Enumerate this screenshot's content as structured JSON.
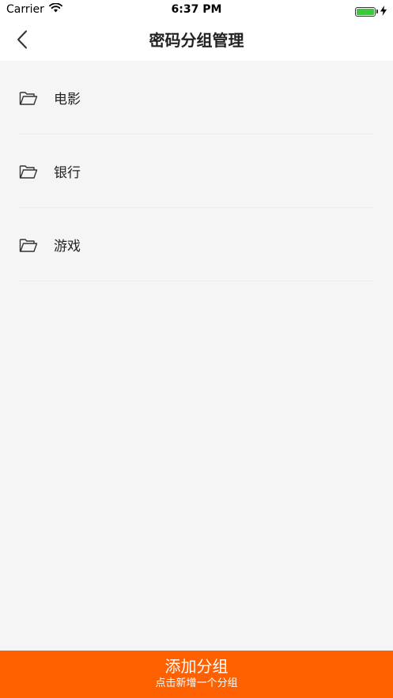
{
  "status_bar": {
    "carrier": "Carrier",
    "time": "6:37 PM",
    "battery_level": 1.0
  },
  "nav": {
    "title": "密码分组管理",
    "back_icon": "chevron-left-icon"
  },
  "groups": [
    {
      "label": "电影",
      "icon": "folder-icon"
    },
    {
      "label": "银行",
      "icon": "folder-icon"
    },
    {
      "label": "游戏",
      "icon": "folder-icon"
    }
  ],
  "add_button": {
    "title": "添加分组",
    "subtitle": "点击新增一个分组"
  },
  "colors": {
    "accent": "#ff6000",
    "background": "#f5f5f5",
    "battery": "#3cc83c"
  }
}
